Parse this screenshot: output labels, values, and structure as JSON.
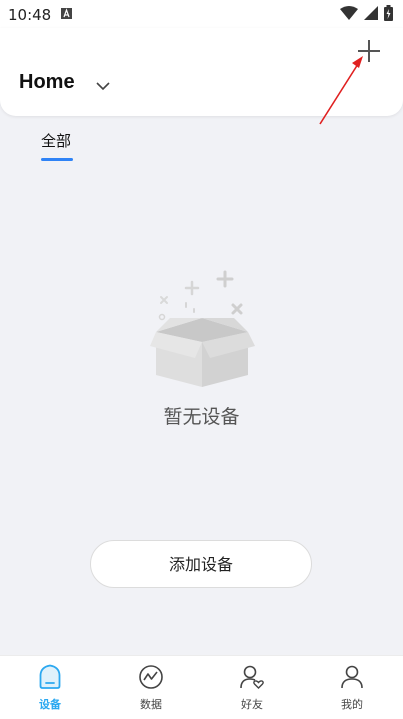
{
  "status_bar": {
    "time": "10:48",
    "notification_icon": "a-box-icon",
    "icons": [
      "wifi-icon",
      "signal-icon",
      "battery-icon"
    ]
  },
  "header": {
    "title": "Home",
    "dropdown_icon": "chevron-down-icon",
    "add_icon": "plus-icon"
  },
  "tabs": [
    {
      "label": "全部",
      "active": true
    }
  ],
  "empty_state": {
    "icon": "empty-box-icon",
    "text": "暂无设备"
  },
  "add_device_button": {
    "label": "添加设备"
  },
  "bottom_nav": {
    "items": [
      {
        "label": "设备",
        "icon": "home-device-icon",
        "active": true
      },
      {
        "label": "数据",
        "icon": "chart-icon",
        "active": false
      },
      {
        "label": "好友",
        "icon": "friends-icon",
        "active": false
      },
      {
        "label": "我的",
        "icon": "profile-icon",
        "active": false
      }
    ]
  },
  "colors": {
    "accent": "#2f83f6",
    "nav_active": "#2ba8f0",
    "annotation_arrow": "#e02020",
    "background": "#f1f2f6"
  }
}
